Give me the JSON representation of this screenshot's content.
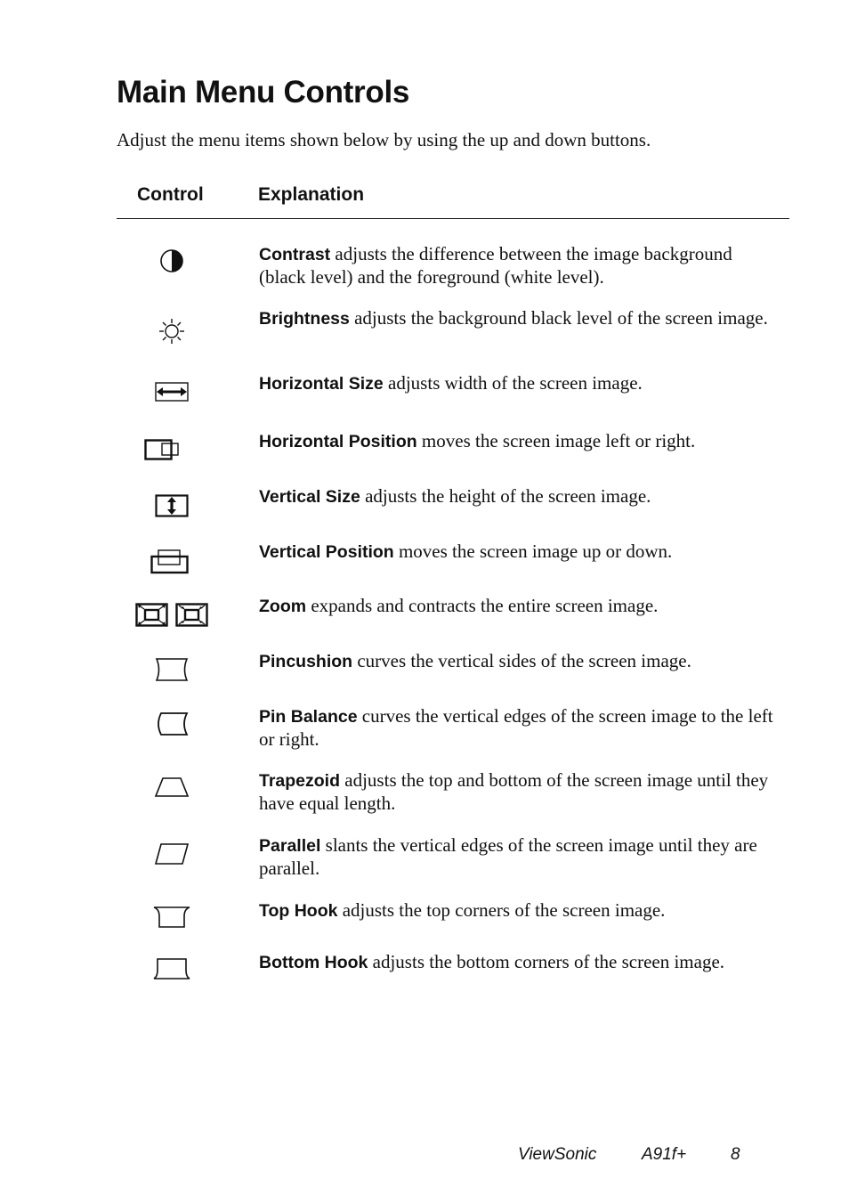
{
  "page": {
    "title": "Main Menu Controls",
    "intro": "Adjust the menu items shown below by using the up and down buttons."
  },
  "table": {
    "headers": {
      "control": "Control",
      "explanation": "Explanation"
    },
    "rows": [
      {
        "icon": "contrast-icon",
        "term": "Contrast",
        "text": " adjusts the difference between the image background (black level) and the foreground (white level)."
      },
      {
        "icon": "brightness-icon",
        "term": "Brightness",
        "text": " adjusts the background black level of the screen image."
      },
      {
        "icon": "horizontal-size-icon",
        "term": "Horizontal Size",
        "text": " adjusts width of the screen image."
      },
      {
        "icon": "horizontal-position-icon",
        "term": "Horizontal Position",
        "text": " moves the screen image left or right."
      },
      {
        "icon": "vertical-size-icon",
        "term": "Vertical Size",
        "text": " adjusts the height of the screen image."
      },
      {
        "icon": "vertical-position-icon",
        "term": "Vertical Position",
        "text": " moves the screen image up or down."
      },
      {
        "icon": "zoom-icon",
        "term": "Zoom",
        "text": " expands and contracts the entire screen image."
      },
      {
        "icon": "pincushion-icon",
        "term": "Pincushion",
        "text": " curves the vertical sides of the screen image."
      },
      {
        "icon": "pin-balance-icon",
        "term": "Pin Balance",
        "text": " curves the vertical edges of the screen image to the left or right."
      },
      {
        "icon": "trapezoid-icon",
        "term": "Trapezoid",
        "text": " adjusts the top and bottom of the screen image until they have equal length."
      },
      {
        "icon": "parallel-icon",
        "term": "Parallel",
        "text": " slants the vertical edges of the screen image until they are parallel."
      },
      {
        "icon": "top-hook-icon",
        "term": "Top Hook",
        "text": " adjusts the top corners of the screen image."
      },
      {
        "icon": "bottom-hook-icon",
        "term": "Bottom Hook",
        "text": " adjusts the bottom corners of the screen image."
      }
    ]
  },
  "footer": {
    "brand": "ViewSonic",
    "model": "A91f+",
    "page_number": "8"
  }
}
